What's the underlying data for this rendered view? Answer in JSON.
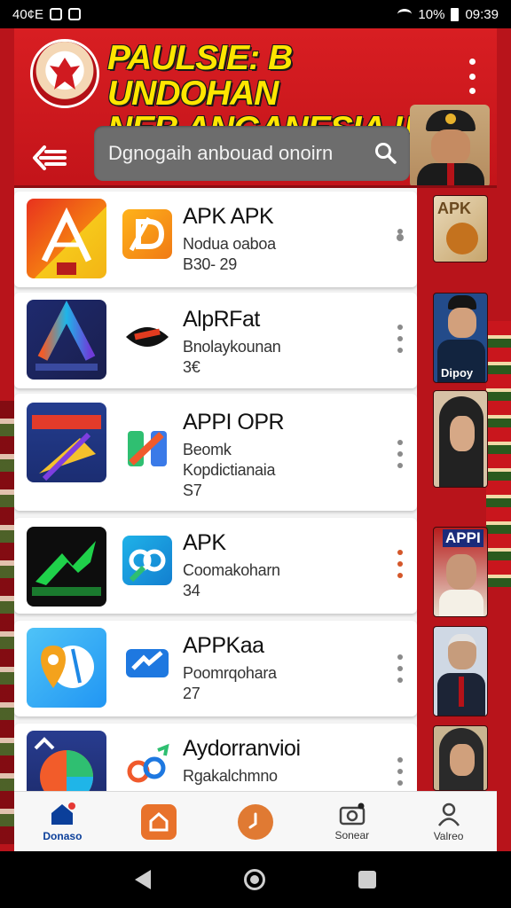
{
  "status_bar": {
    "time": "40¢E",
    "battery": "10%",
    "clock": "09:39"
  },
  "header": {
    "title_line1": "PAULSIE: B UNDOHAN",
    "title_line2": "NEB ANGANESIA !!",
    "accent_color": "#d81e22",
    "title_color": "#ffe600"
  },
  "search": {
    "placeholder": "Dgnogaih anbouad onoirn"
  },
  "apps": [
    {
      "title": "APK APK",
      "line1": "Noduа оаbоа",
      "line2": "B30- 29",
      "kebab": "grey"
    },
    {
      "title": "AlpRFat",
      "line1": "Bnolaykounan",
      "line2": "3€",
      "kebab": "grey"
    },
    {
      "title": "APPI OPR",
      "line1": "Beomk",
      "line2": "Kopdictianaia",
      "line3": "S7",
      "kebab": "grey"
    },
    {
      "title": "APK",
      "line1": "Coomakoharn",
      "line2": "34",
      "kebab": "orange"
    },
    {
      "title": "APPKaa",
      "line1": "Poomrqohara",
      "line2": "27",
      "kebab": "grey"
    },
    {
      "title": "Aydorranvioi",
      "line1": "Rgakalchmno",
      "line2": "",
      "kebab": "grey"
    }
  ],
  "icons": {
    "big": [
      "red-yellow-logo-icon",
      "blue-a-logo-icon",
      "bianbian-logo-icon",
      "green-arrow-logo-icon",
      "blue-map-pin-icon",
      "blue-chart-icon"
    ],
    "small": [
      "orange-d-icon",
      "mask-icon",
      "colorful-blocks-icon",
      "cyan-link-icon",
      "blue-arrows-icon",
      "colorful-knot-icon"
    ]
  },
  "side_thumbs": [
    {
      "label": "APK"
    },
    {
      "label": "Dipoy"
    },
    {
      "label": ""
    },
    {
      "label": "APPI"
    },
    {
      "label": ""
    },
    {
      "label": ""
    }
  ],
  "bottom_nav": [
    {
      "label": "Donaso",
      "icon": "home-icon",
      "active": true
    },
    {
      "label": "",
      "icon": "orange-home-icon",
      "active": false
    },
    {
      "label": "",
      "icon": "orange-clock-icon",
      "active": false
    },
    {
      "label": "Sonear",
      "icon": "camera-icon",
      "active": false
    },
    {
      "label": "Valreo",
      "icon": "user-icon",
      "active": false
    }
  ]
}
